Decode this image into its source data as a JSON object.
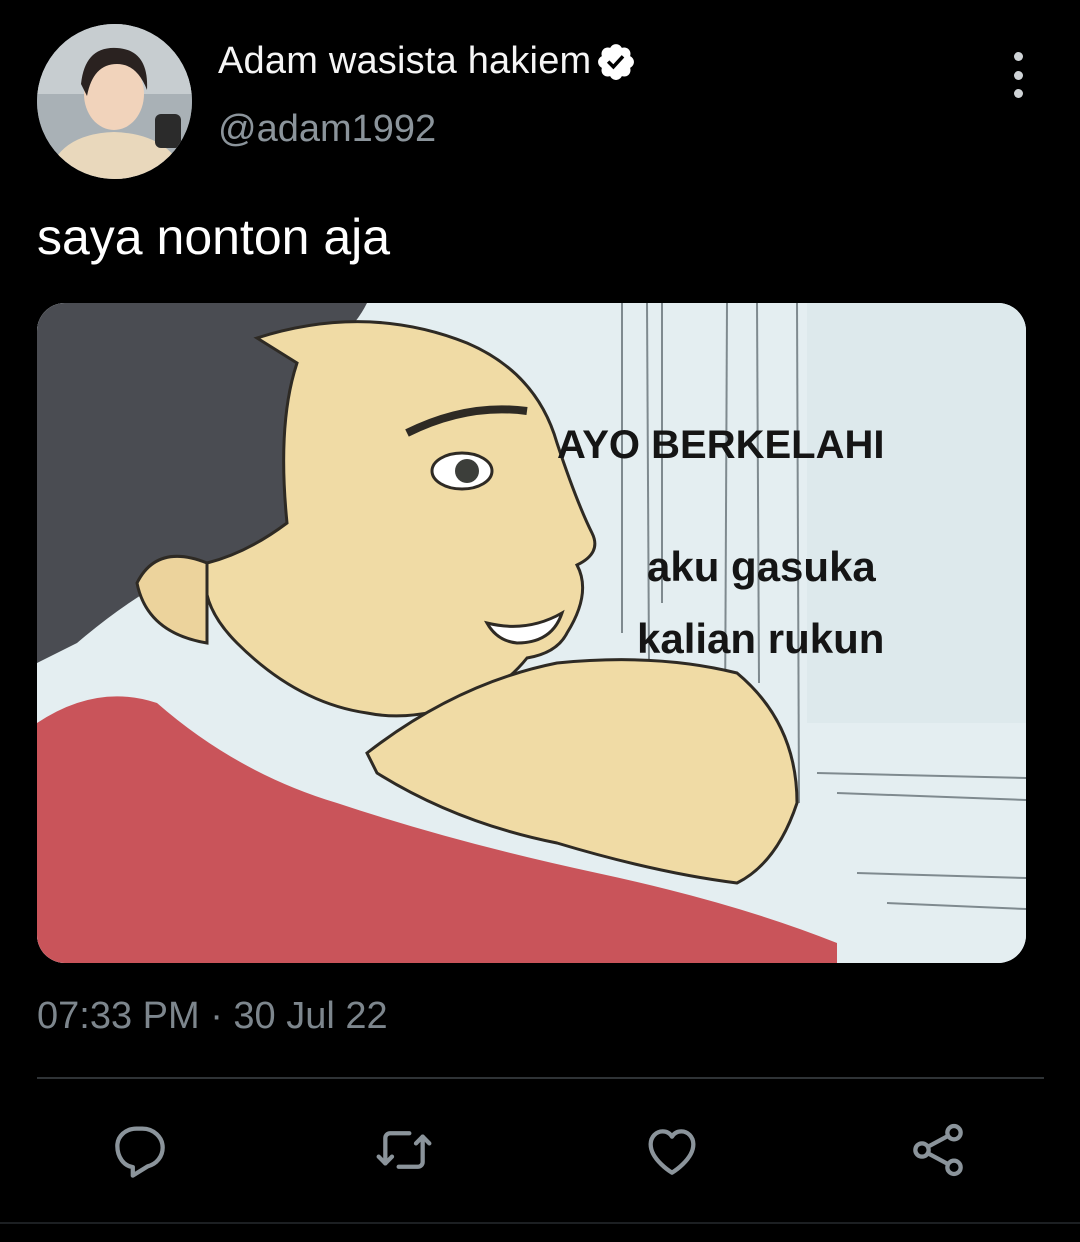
{
  "tweet": {
    "author_name": "Adam wasista hakiem",
    "handle": "@adam1992",
    "text": "saya nonton aja",
    "timestamp": "07:33 PM · 30 Jul 22",
    "verified": true
  },
  "media": {
    "caption_top": "AYO BERKELAHI",
    "caption_line1": "aku gasuka",
    "caption_line2": "kalian rukun"
  },
  "icons": {
    "more": "more-vertical-icon",
    "verified": "verified-badge-icon",
    "reply": "reply-icon",
    "retweet": "retweet-icon",
    "like": "like-icon",
    "share": "share-icon"
  },
  "colors": {
    "background": "#000000",
    "secondary_text": "#8b949b",
    "divider": "#2f3336",
    "icon": "#8b949b"
  }
}
